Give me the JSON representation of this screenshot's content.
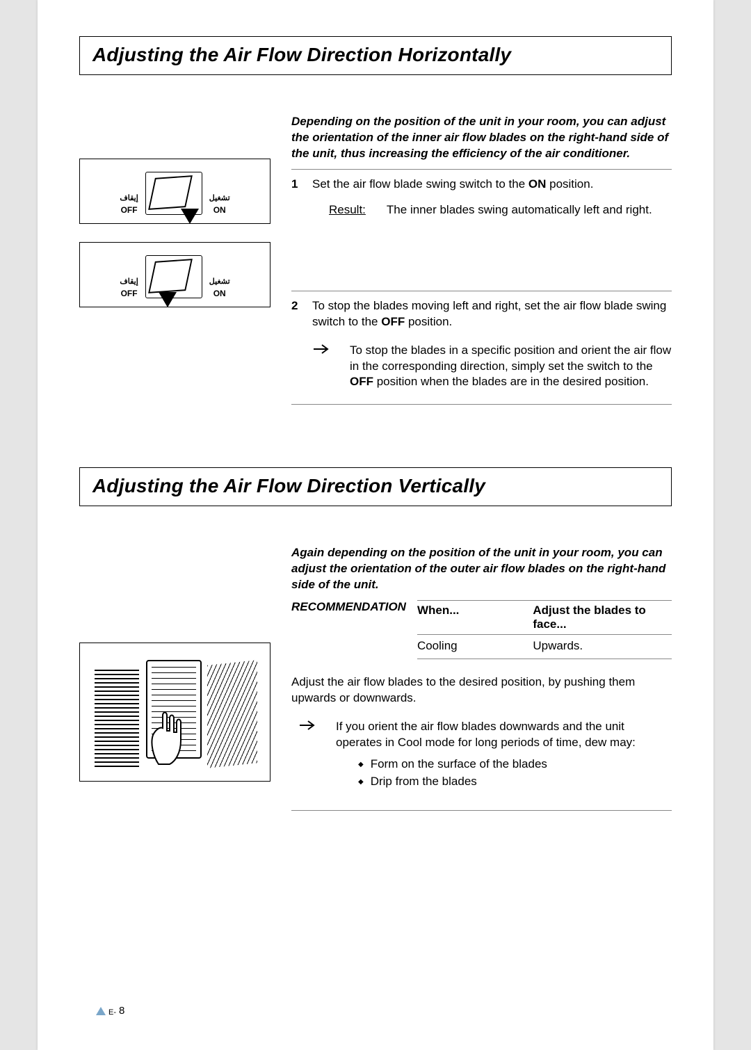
{
  "section1": {
    "title": "Adjusting the Air Flow Direction Horizontally",
    "intro": "Depending on the position of the unit in your room, you can adjust the orientation of the inner air flow blades on the right-hand side of the unit, thus increasing the efficiency of the air conditioner.",
    "step1_num": "1",
    "step1_a": "Set the air flow blade swing switch to the ",
    "step1_bold": "ON",
    "step1_b": " position.",
    "result_label": "Result:",
    "result_text": "The inner blades swing automatically left and right.",
    "step2_num": "2",
    "step2_a": "To stop the blades moving left and right, set the air flow blade swing switch to the ",
    "step2_bold": "OFF",
    "step2_b": " position.",
    "note_a": "To stop the blades in a specific position and orient the air flow in the corresponding direction, simply set the switch to the ",
    "note_bold": "OFF",
    "note_b": " position when the blades are in the desired position.",
    "switch": {
      "off_ar": "إيقاف",
      "off_en": "OFF",
      "on_ar": "تشغيل",
      "on_en": "ON"
    }
  },
  "section2": {
    "title": "Adjusting the Air Flow Direction Vertically",
    "intro": "Again depending on the position of the unit in your room, you can adjust the orientation of the outer air flow blades on the right-hand side of the unit.",
    "rec_label": "RECOMMENDATION",
    "rec_header_when": "When...",
    "rec_header_adjust": "Adjust the blades to face...",
    "rec_row_when": "Cooling",
    "rec_row_adjust": "Upwards.",
    "body_text": "Adjust the air flow blades to the desired position, by pushing them upwards or downwards.",
    "note_text": "If you orient the air flow blades downwards and the unit operates in Cool mode for long periods of time, dew may:",
    "bullets": {
      "b1": "Form on the surface of the blades",
      "b2": "Drip from the blades"
    }
  },
  "page": {
    "prefix": "E-",
    "num": "8"
  }
}
